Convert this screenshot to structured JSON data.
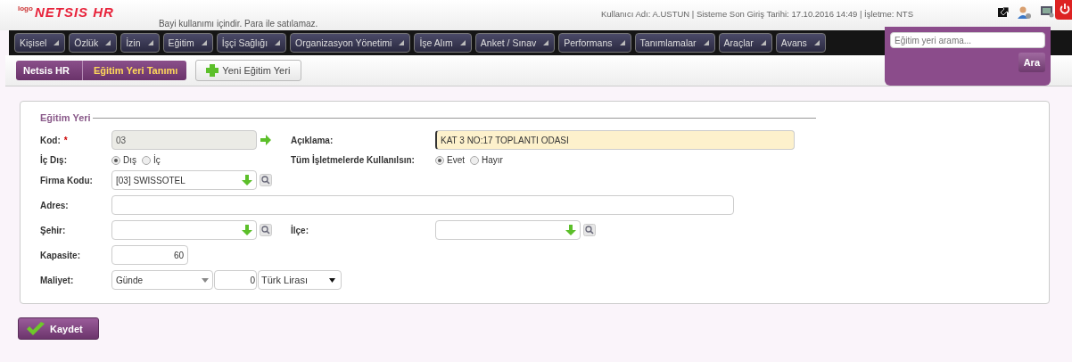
{
  "header": {
    "logo_small": "logo",
    "logo": "NETSIS HR",
    "notice": "Bayi kullanımı içindir. Para ile satılamaz.",
    "user_info": "Kullanıcı Adı: A.USTUN | Sisteme Son Giriş Tarihi: 17.10.2016 14:49 | İşletme: NTS"
  },
  "menu": [
    {
      "label": "Kişisel"
    },
    {
      "label": "Özlük"
    },
    {
      "label": "İzin"
    },
    {
      "label": "Eğitim"
    },
    {
      "label": "İşçi Sağlığı"
    },
    {
      "label": "Organizasyon Yönetimi"
    },
    {
      "label": "İşe Alım"
    },
    {
      "label": "Anket / Sınav"
    },
    {
      "label": "Performans"
    },
    {
      "label": "Tanımlamalar"
    },
    {
      "label": "Araçlar"
    },
    {
      "label": "Avans"
    }
  ],
  "breadcrumb": [
    "Netsis HR",
    "Eğitim Yeri Tanımı"
  ],
  "new_button": "Yeni Eğitim Yeri",
  "search": {
    "placeholder": "Eğitim yeri arama...",
    "button": "Ara"
  },
  "form": {
    "legend": "Eğitim Yeri",
    "rows": [
      {
        "fields": [
          {
            "kind": "code",
            "label": "Kod:",
            "required_mark": "*",
            "value": "03",
            "disabled": true
          },
          {
            "kind": "text",
            "label": "Açıklama:",
            "value": "KAT 3 NO:17 TOPLANTI ODASI",
            "focused": true
          }
        ]
      },
      {
        "fields": [
          {
            "kind": "radio",
            "label": "İç Dış:",
            "options": [
              {
                "label": "Dış",
                "selected": true
              },
              {
                "label": "İç",
                "selected": false
              }
            ]
          },
          {
            "kind": "radio",
            "label": "Tüm İşletmelerde Kullanılsın:",
            "options": [
              {
                "label": "Evet",
                "selected": true
              },
              {
                "label": "Hayır",
                "selected": false
              }
            ]
          }
        ]
      },
      {
        "fields": [
          {
            "kind": "lookup",
            "label": "Firma Kodu:",
            "value": "[03] SWISSOTEL"
          }
        ]
      },
      {
        "fields": [
          {
            "kind": "wide",
            "label": "Adres:"
          }
        ]
      },
      {
        "fields": [
          {
            "kind": "lookup",
            "label": "Şehir:"
          },
          {
            "kind": "lookup",
            "label": "İlçe:"
          }
        ]
      },
      {
        "fields": [
          {
            "kind": "number",
            "label": "Kapasite:",
            "value": "60"
          }
        ]
      },
      {
        "fields": [
          {
            "kind": "cost",
            "label": "Maliyet:",
            "period": "Günde",
            "amount": "0",
            "currency": "Türk Lirası"
          }
        ]
      }
    ]
  },
  "save_button": "Kaydet"
}
